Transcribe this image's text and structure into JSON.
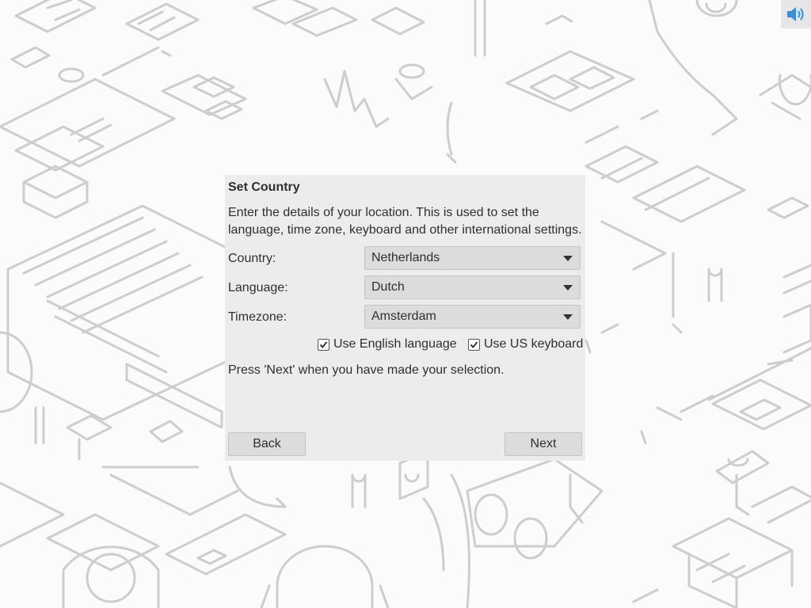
{
  "system": {
    "volume_icon": "speaker-volume-icon"
  },
  "dialog": {
    "title": "Set Country",
    "description": "Enter the details of your location. This is used to set the language, time zone, keyboard and other international settings.",
    "country": {
      "label": "Country:",
      "value": "Netherlands"
    },
    "language": {
      "label": "Language:",
      "value": "Dutch"
    },
    "timezone": {
      "label": "Timezone:",
      "value": "Amsterdam"
    },
    "use_english": {
      "label": "Use English language",
      "checked": true
    },
    "use_us_keyboard": {
      "label": "Use US keyboard",
      "checked": true
    },
    "hint": "Press 'Next' when you have made your selection.",
    "back_label": "Back",
    "next_label": "Next"
  }
}
